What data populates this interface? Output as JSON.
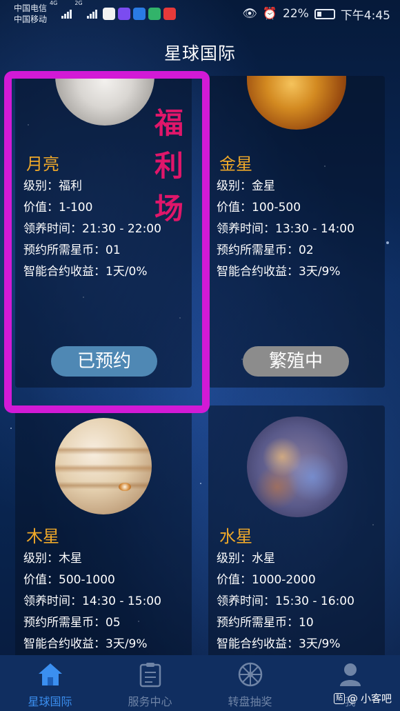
{
  "status_bar": {
    "carrier_1": "中国电信",
    "carrier_2": "中国移动",
    "network_1": "4G",
    "network_2": "2G",
    "battery": "22%",
    "time": "下午4:45"
  },
  "header": {
    "title": "星球国际"
  },
  "planets": [
    {
      "name": "月亮",
      "level": "级别：福利",
      "value": "价值：1-100",
      "claim_time": "领养时间：21:30 - 22:00",
      "coins": "预约所需星币：01",
      "yield": "智能合约收益：1天/0%",
      "button": "已预约"
    },
    {
      "name": "金星",
      "level": "级别：金星",
      "value": "价值：100-500",
      "claim_time": "领养时间：13:30 - 14:00",
      "coins": "预约所需星币：02",
      "yield": "智能合约收益：3天/9%",
      "button": "繁殖中"
    },
    {
      "name": "木星",
      "level": "级别：木星",
      "value": "价值：500-1000",
      "claim_time": "领养时间：14:30 - 15:00",
      "coins": "预约所需星币：05",
      "yield": "智能合约收益：3天/9%"
    },
    {
      "name": "水星",
      "level": "级别：水星",
      "value": "价值：1000-2000",
      "claim_time": "领养时间：15:30 - 16:00",
      "coins": "预约所需星币：10",
      "yield": "智能合约收益：3天/9%"
    }
  ],
  "annotation": {
    "chars": [
      "福",
      "利",
      "场"
    ],
    "color": "#e0166a",
    "frame_color": "#d21ad6"
  },
  "tabbar": {
    "tabs": [
      {
        "label": "星球国际",
        "icon": "home-icon",
        "active": true
      },
      {
        "label": "服务中心",
        "icon": "clipboard-icon",
        "active": false
      },
      {
        "label": "转盘抽奖",
        "icon": "wheel-icon",
        "active": false
      },
      {
        "label": "我",
        "icon": "user-icon",
        "active": false
      }
    ]
  },
  "watermark": {
    "badge": "贴",
    "text": "小客吧"
  },
  "colors": {
    "accent": "#3b8ff0",
    "planet_name": "#f0a929",
    "reserved_button": "#4f88b4",
    "breeding_button": "#8c8c8c"
  }
}
